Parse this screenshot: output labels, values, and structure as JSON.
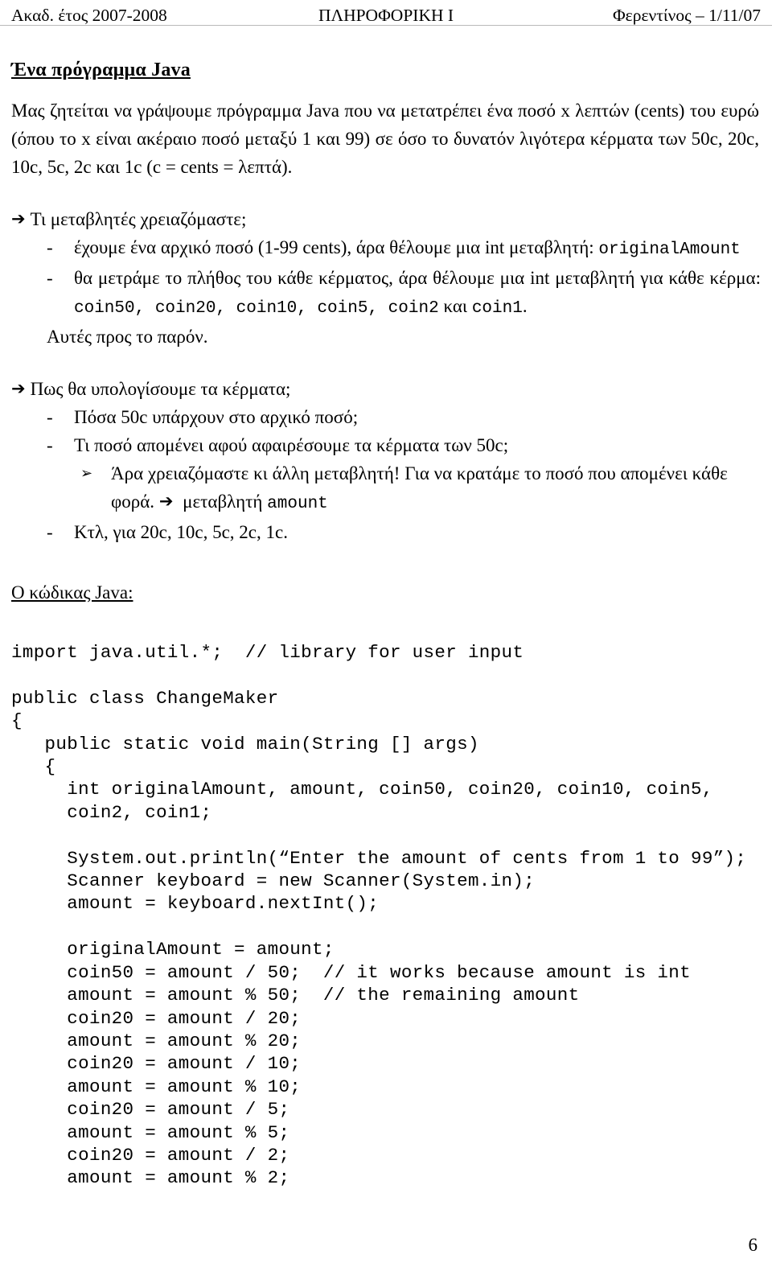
{
  "header": {
    "left": "Ακαδ. έτος 2007-2008",
    "center": "ΠΛΗΡΟΦΟΡΙΚΗ Ι",
    "right": "Φερεντίνος – 1/11/07"
  },
  "title": "Ένα πρόγραμμα Java",
  "intro": "Μας ζητείται να γράψουμε πρόγραμμα Java που να μετατρέπει ένα ποσό x λεπτών (cents) του ευρώ (όπου το x είναι ακέραιο ποσό μεταξύ 1 και 99) σε όσο το δυνατόν λιγότερα κέρματα των 50c, 20c, 10c, 5c, 2c και 1c  (c = cents = λεπτά).",
  "section1": {
    "arrow_glyph": "➔",
    "heading": "Τι μεταβλητές χρειαζόμαστε;",
    "dash_glyph": "-",
    "item1_text": "έχουμε ένα αρχικό ποσό (1-99 cents), άρα θέλουμε μια int μεταβλητή:",
    "item1_code": "originalAmount",
    "item2_text": "θα μετράμε το πλήθος του κάθε κέρματος, άρα θέλουμε μια int μεταβλητή για κάθε κέρμα: ",
    "item2_code_a": "coin50, coin20, coin10, coin5, coin2",
    "item2_mid": " και ",
    "item2_code_b": "coin1",
    "item2_end": ".",
    "closing": "Αυτές προς το παρόν."
  },
  "section2": {
    "arrow_glyph": "➔",
    "heading": "Πως θα υπολογίσουμε τα κέρματα;",
    "dash_glyph": "-",
    "tri_glyph": "➢",
    "item1": "Πόσα 50c υπάρχουν στο αρχικό ποσό;",
    "item2": "Τι ποσό απομένει αφού αφαιρέσουμε τα κέρματα των 50c;",
    "sub1_text": "Άρα χρειαζόμαστε κι άλλη μεταβλητή! Για να κρατάμε το ποσό που απομένει κάθε φορά. ",
    "sub1_arrow": "➔",
    "sub1_tail": " μεταβλητή ",
    "sub1_code": "amount",
    "item3": "Κτλ, για 20c, 10c, 5c, 2c, 1c."
  },
  "code_heading": "Ο κώδικας Java:",
  "code": "import java.util.*;  // library for user input\n\npublic class ChangeMaker\n{\n   public static void main(String [] args)\n   {\n     int originalAmount, amount, coin50, coin20, coin10, coin5,\n     coin2, coin1;\n\n     System.out.println(“Enter the amount of cents from 1 to 99”);\n     Scanner keyboard = new Scanner(System.in);\n     amount = keyboard.nextInt();\n\n     originalAmount = amount;\n     coin50 = amount / 50;  // it works because amount is int\n     amount = amount % 50;  // the remaining amount\n     coin20 = amount / 20;\n     amount = amount % 20;\n     coin20 = amount / 10;\n     amount = amount % 10;\n     coin20 = amount / 5;\n     amount = amount % 5;\n     coin20 = amount / 2;\n     amount = amount % 2;",
  "page_number": "6"
}
